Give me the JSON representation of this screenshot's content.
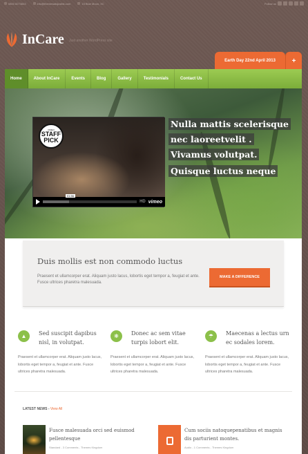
{
  "topbar": {
    "phone": "0800 8273843",
    "email": "info@themewalsjustbk.com",
    "address": "15 Blue Moon, XC",
    "follow": "Follow us"
  },
  "header": {
    "logo_text": "InCare",
    "tagline": "Just another WordPress site",
    "event_tab": "Earth Day 22nd April 2013",
    "plus": "+"
  },
  "nav": {
    "items": [
      "Home",
      "About InCare",
      "Events",
      "Blog",
      "Gallery",
      "Testimonials",
      "Contact Us"
    ]
  },
  "hero": {
    "video": {
      "badge_top": "VIMEO",
      "badge_main1": "STAFF",
      "badge_main2": "PICK",
      "time": "01:56",
      "hd": "HD",
      "brand": "vimeo"
    },
    "captions": [
      "Nulla mattis scelerisque",
      "nec laoreetvelit .",
      "Vivamus volutpat.",
      "Quisque luctus neque"
    ]
  },
  "callout": {
    "title": "Duis mollis est non commodo luctus",
    "text": "Praesent et ullamcorper erat. Aliquam justo lacus, lobortis eget tempor a, feugiat et ante. Fusce ultrices pharetra malesuada.",
    "button": "MAKE A DIFFERENCE"
  },
  "features": [
    {
      "icon": "tree-icon",
      "title": "Sed suscipit dapibus nisl, in volutpat.",
      "text": "Praesent et ullamcorper erat. Aliquam justo lacus, lobortis eget tempor a, feugiat et ante. Fusce ultrices pharetra malesuada."
    },
    {
      "icon": "paw-icon",
      "title": "Donec ac sem vitae turpis lobort elit.",
      "text": "Praesent et ullamcorper erat. Aliquam justo lacus, lobortis eget tempor a, feugiat et ante. Fusce ultrices pharetra malesuada."
    },
    {
      "icon": "umbrella-icon",
      "title": "Maecenas a lectus urn ec sodales lorem.",
      "text": "Praesent et ullamcorper erat. Aliquam justo lacus, lobortis eget tempor a, feugiat et ante. Fusce ultrices pharetra malesuada."
    }
  ],
  "news": {
    "heading": "LATEST NEWS",
    "sep": " - ",
    "view_all": "View All",
    "items": [
      {
        "title": "Fusce malesuada orci sed euismod pellentesque",
        "meta": "Standard - 3 Comments - Themes Kingdom"
      },
      {
        "title": "Cum sociis natoquepenatibus et magnis dis parturient montes.",
        "meta": "Audio - 1 Comments - Themes Kingdom"
      }
    ]
  },
  "colors": {
    "accent": "#ec6a33",
    "nav_green": "#8cc04a",
    "background": "#6b5751"
  }
}
